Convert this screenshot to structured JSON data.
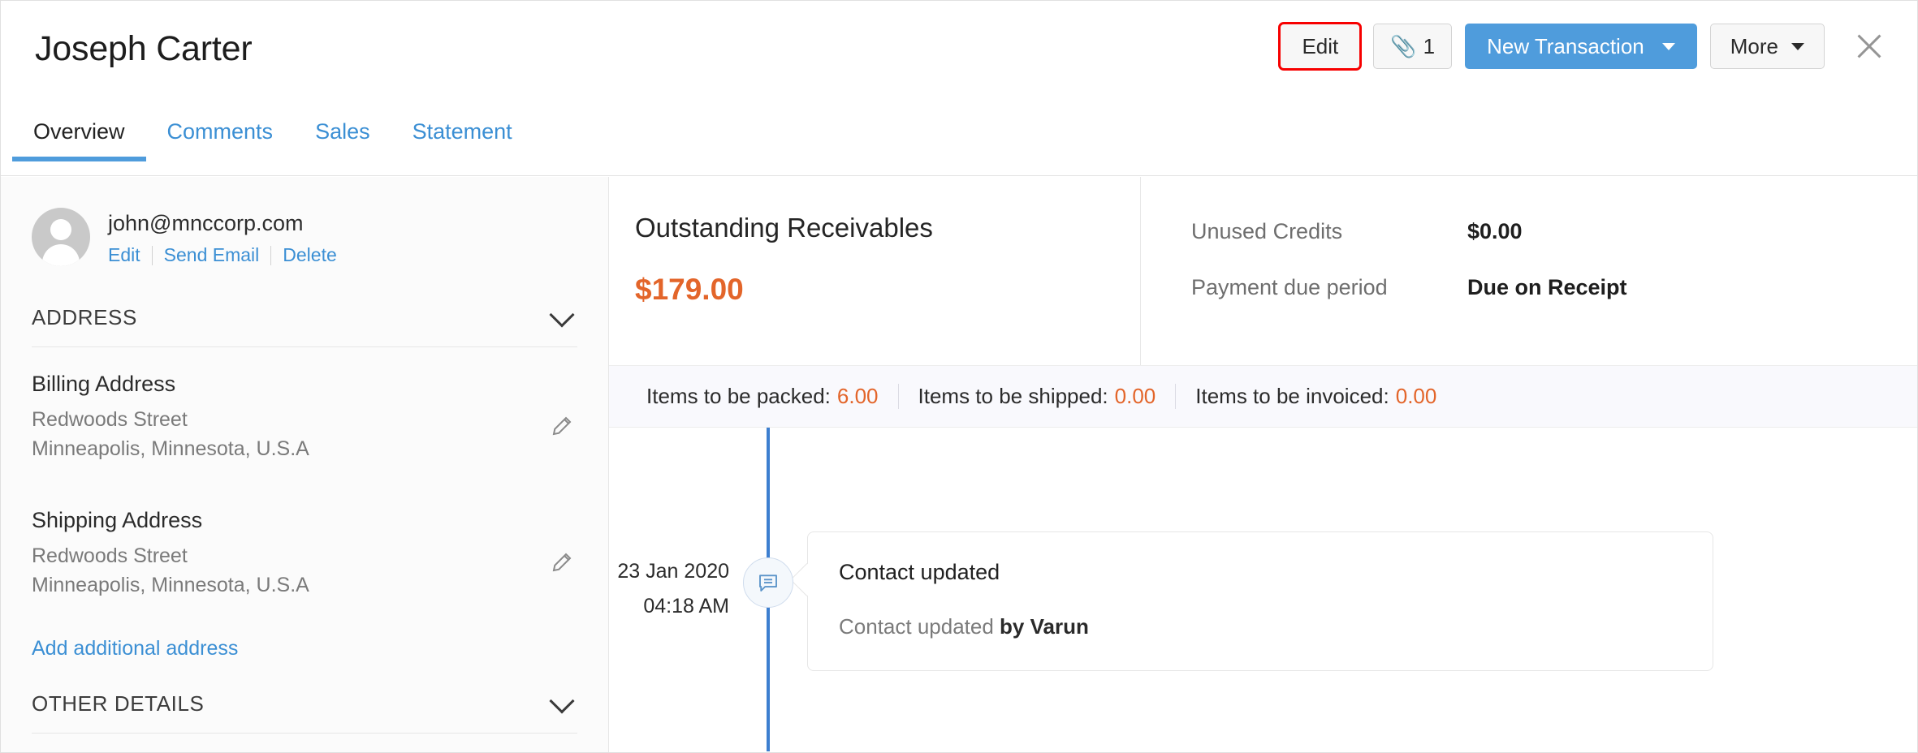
{
  "header": {
    "title": "Joseph Carter",
    "actions": {
      "edit_label": "Edit",
      "attachment_icon": "paperclip-icon",
      "attachment_count": "1",
      "new_transaction_label": "New Transaction",
      "more_label": "More",
      "close_icon": "close-icon",
      "highlight_color": "#f70000",
      "primary_color": "#4f9cdc"
    }
  },
  "tabs": [
    {
      "label": "Overview",
      "active": true
    },
    {
      "label": "Comments",
      "active": false
    },
    {
      "label": "Sales",
      "active": false
    },
    {
      "label": "Statement",
      "active": false
    }
  ],
  "sidebar": {
    "avatar_icon": "user-avatar-placeholder",
    "email": "john@mnccorp.com",
    "links": [
      "Edit",
      "Send Email",
      "Delete"
    ],
    "address_section": {
      "title": "ADDRESS",
      "chevron_icon": "chevron-down-icon",
      "billing": {
        "title": "Billing Address",
        "line1": "Redwoods Street",
        "line2": "Minneapolis, Minnesota, U.S.A",
        "edit_icon": "pencil-icon"
      },
      "shipping": {
        "title": "Shipping Address",
        "line1": "Redwoods Street",
        "line2": "Minneapolis, Minnesota, U.S.A",
        "edit_icon": "pencil-icon"
      },
      "add_link": "Add additional address"
    },
    "other_details_section": {
      "title": "OTHER DETAILS",
      "chevron_icon": "chevron-down-icon"
    }
  },
  "main": {
    "receivables": {
      "title": "Outstanding Receivables",
      "amount": "$179.00",
      "amount_color": "#e3652a"
    },
    "details": [
      {
        "label": "Unused Credits",
        "value": "$0.00"
      },
      {
        "label": "Payment due period",
        "value": "Due on Receipt"
      }
    ],
    "items_bar": [
      {
        "label": "Items to be packed:",
        "value": "6.00"
      },
      {
        "label": "Items to be shipped:",
        "value": "0.00"
      },
      {
        "label": "Items to be invoiced:",
        "value": "0.00"
      }
    ],
    "timeline": [
      {
        "date": "23 Jan 2020",
        "time": "04:18 AM",
        "icon": "comment-bubble-icon",
        "title": "Contact updated",
        "subject": "Contact updated",
        "actor": "by Varun"
      }
    ]
  }
}
